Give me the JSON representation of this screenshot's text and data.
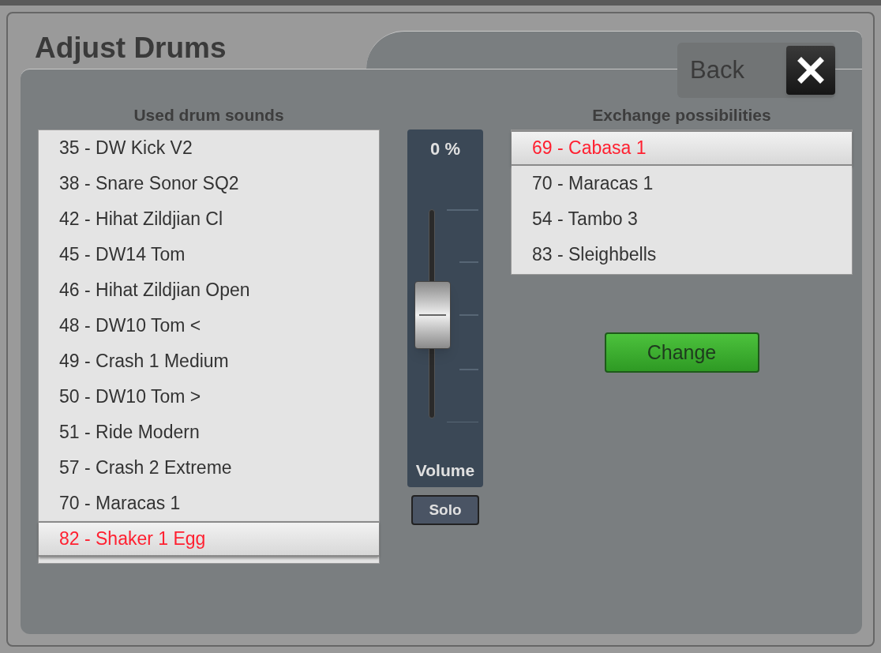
{
  "window": {
    "title": "Adjust Drums"
  },
  "back_button": {
    "label": "Back"
  },
  "used_sounds": {
    "heading": "Used drum sounds",
    "items": [
      {
        "label": "35 - DW Kick V2",
        "selected": false
      },
      {
        "label": "38 - Snare Sonor SQ2",
        "selected": false
      },
      {
        "label": "42 - Hihat Zildjian Cl",
        "selected": false
      },
      {
        "label": "45 - DW14 Tom",
        "selected": false
      },
      {
        "label": "46 - Hihat Zildjian Open",
        "selected": false
      },
      {
        "label": "48 - DW10 Tom <",
        "selected": false
      },
      {
        "label": "49 - Crash 1 Medium",
        "selected": false
      },
      {
        "label": "50 - DW10 Tom >",
        "selected": false
      },
      {
        "label": "51 - Ride Modern",
        "selected": false
      },
      {
        "label": "57 - Crash 2 Extreme",
        "selected": false
      },
      {
        "label": "70 - Maracas 1",
        "selected": false
      },
      {
        "label": "82 - Shaker 1 Egg",
        "selected": true
      }
    ]
  },
  "volume": {
    "reading": "0 %",
    "level": 0.5,
    "label": "Volume"
  },
  "solo_button": {
    "label": "Solo"
  },
  "exchange": {
    "heading": "Exchange possibilities",
    "items": [
      {
        "label": "69 - Cabasa 1",
        "selected": true
      },
      {
        "label": "70 - Maracas 1",
        "selected": false
      },
      {
        "label": "54 - Tambo 3",
        "selected": false
      },
      {
        "label": "83 - Sleighbells",
        "selected": false
      }
    ]
  },
  "change_button": {
    "label": "Change"
  }
}
